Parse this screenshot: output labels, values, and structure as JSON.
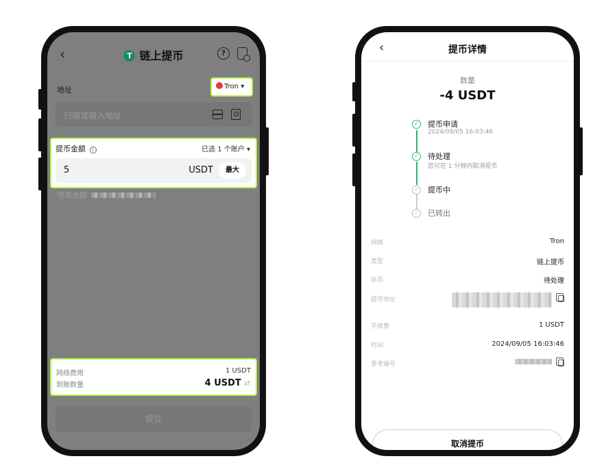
{
  "left": {
    "header": {
      "title": "链上提币",
      "coin_icon_glyph": "T",
      "back_glyph": "‹",
      "help_glyph": "?"
    },
    "address": {
      "label": "地址",
      "network": "Tron",
      "placeholder": "扫描或输入地址"
    },
    "amount": {
      "label": "提币金额",
      "account_selector": "已选 1 个账户",
      "value": "5",
      "unit": "USDT",
      "max_label": "最大",
      "balance_label": "可用余额"
    },
    "fees": {
      "network_fee_label": "网络费用",
      "network_fee_value": "1 USDT",
      "received_label": "到账数量",
      "received_value": "4 USDT"
    },
    "submit_label": "提交"
  },
  "right": {
    "header": {
      "title": "提币详情",
      "back_glyph": "‹"
    },
    "quantity_label": "数量",
    "quantity_value": "-4 USDT",
    "steps": [
      {
        "title": "提币申请",
        "subtitle": "2024/09/05 16:03:46",
        "status": "done"
      },
      {
        "title": "待处理",
        "subtitle": "您可在 1 分钟内取消提币",
        "status": "done"
      },
      {
        "title": "提币中",
        "subtitle": "",
        "status": "pending"
      },
      {
        "title": "已转出",
        "subtitle": "",
        "status": "pending"
      }
    ],
    "details": {
      "network_label": "网络",
      "network_value": "Tron",
      "type_label": "类型",
      "type_value": "链上提币",
      "status_label": "状态",
      "status_value": "待处理",
      "address_label": "提币地址",
      "fee_label": "手续费",
      "fee_value": "1 USDT",
      "time_label": "时间",
      "time_value": "2024/09/05 16:03:46",
      "ref_label": "参考编号"
    },
    "cancel_label": "取消提币"
  },
  "colors": {
    "highlight": "#b7f34a",
    "success": "#2fb36a",
    "tron": "#e8373e",
    "coin": "#1b8a6b"
  },
  "icons": [
    "back-icon",
    "usdt-coin-icon",
    "help-icon",
    "history-icon",
    "tron-icon",
    "scan-icon",
    "address-book-icon",
    "info-icon",
    "swap-icon",
    "check-icon",
    "copy-icon"
  ]
}
